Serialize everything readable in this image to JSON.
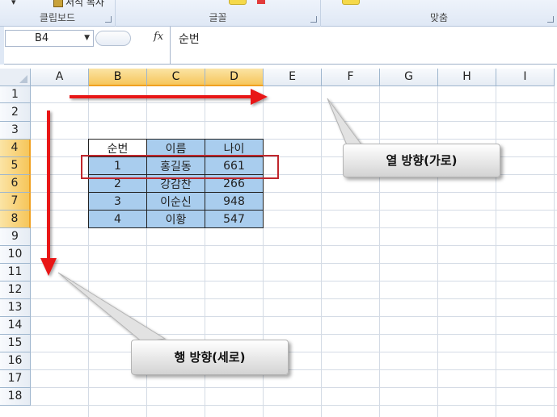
{
  "ribbon": {
    "paste_label": "▾",
    "format_copy_label": "서식 복사",
    "groups": {
      "clipboard": "클립보드",
      "font": "글꼴",
      "alignment": "맞춤"
    }
  },
  "formula_bar": {
    "name_box": "B4",
    "fx_label": "fx",
    "formula_value": "순번"
  },
  "columns": [
    "A",
    "B",
    "C",
    "D",
    "E",
    "F",
    "G",
    "H",
    "I"
  ],
  "rows": [
    "1",
    "2",
    "3",
    "4",
    "5",
    "6",
    "7",
    "8",
    "9",
    "10",
    "11",
    "12",
    "13",
    "14",
    "15",
    "16",
    "17",
    "18"
  ],
  "selected_columns": [
    "B",
    "C",
    "D"
  ],
  "selected_rows": [
    "4",
    "5",
    "6",
    "7",
    "8"
  ],
  "table": {
    "headers": [
      "순번",
      "이름",
      "나이"
    ],
    "rows": [
      [
        "1",
        "홍길동",
        "661"
      ],
      [
        "2",
        "강감찬",
        "266"
      ],
      [
        "3",
        "이순신",
        "948"
      ],
      [
        "4",
        "이황",
        "547"
      ]
    ]
  },
  "annotations": {
    "column_direction": "열 방향(가로)",
    "row_direction": "행 방향(세로)"
  },
  "colors": {
    "selection_fill": "#a9cdee",
    "header_highlight": "#f6c65b",
    "arrow_red": "#e81414",
    "row_box": "#c0262c"
  }
}
